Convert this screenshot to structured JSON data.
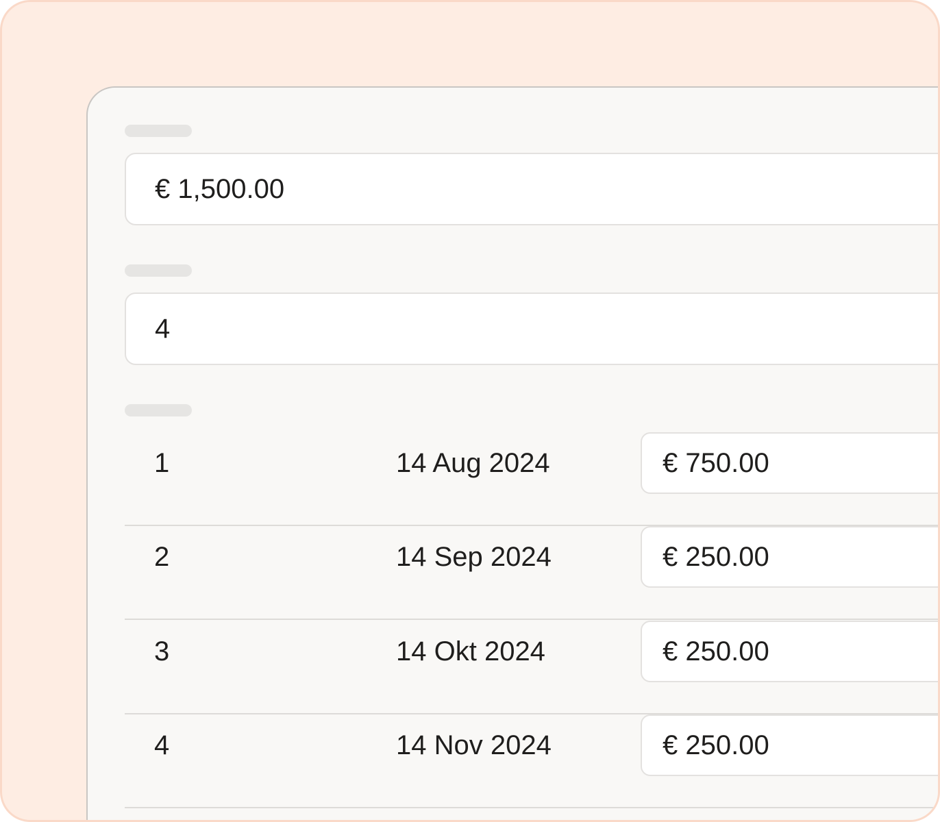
{
  "total_amount": {
    "value": "€ 1,500.00"
  },
  "installments_count": {
    "value": "4"
  },
  "schedule": {
    "rows": [
      {
        "number": "1",
        "date": "14 Aug 2024",
        "amount": "€ 750.00"
      },
      {
        "number": "2",
        "date": "14 Sep 2024",
        "amount": "€ 250.00"
      },
      {
        "number": "3",
        "date": "14 Okt 2024",
        "amount": "€ 250.00"
      },
      {
        "number": "4",
        "date": "14 Nov 2024",
        "amount": "€ 250.00"
      }
    ]
  },
  "colors": {
    "outer_background": "#FEEDE3",
    "panel_background": "#F9F8F6",
    "input_background": "#FFFFFF",
    "text": "#1F1E1D",
    "placeholder_bar": "#E6E5E3"
  }
}
